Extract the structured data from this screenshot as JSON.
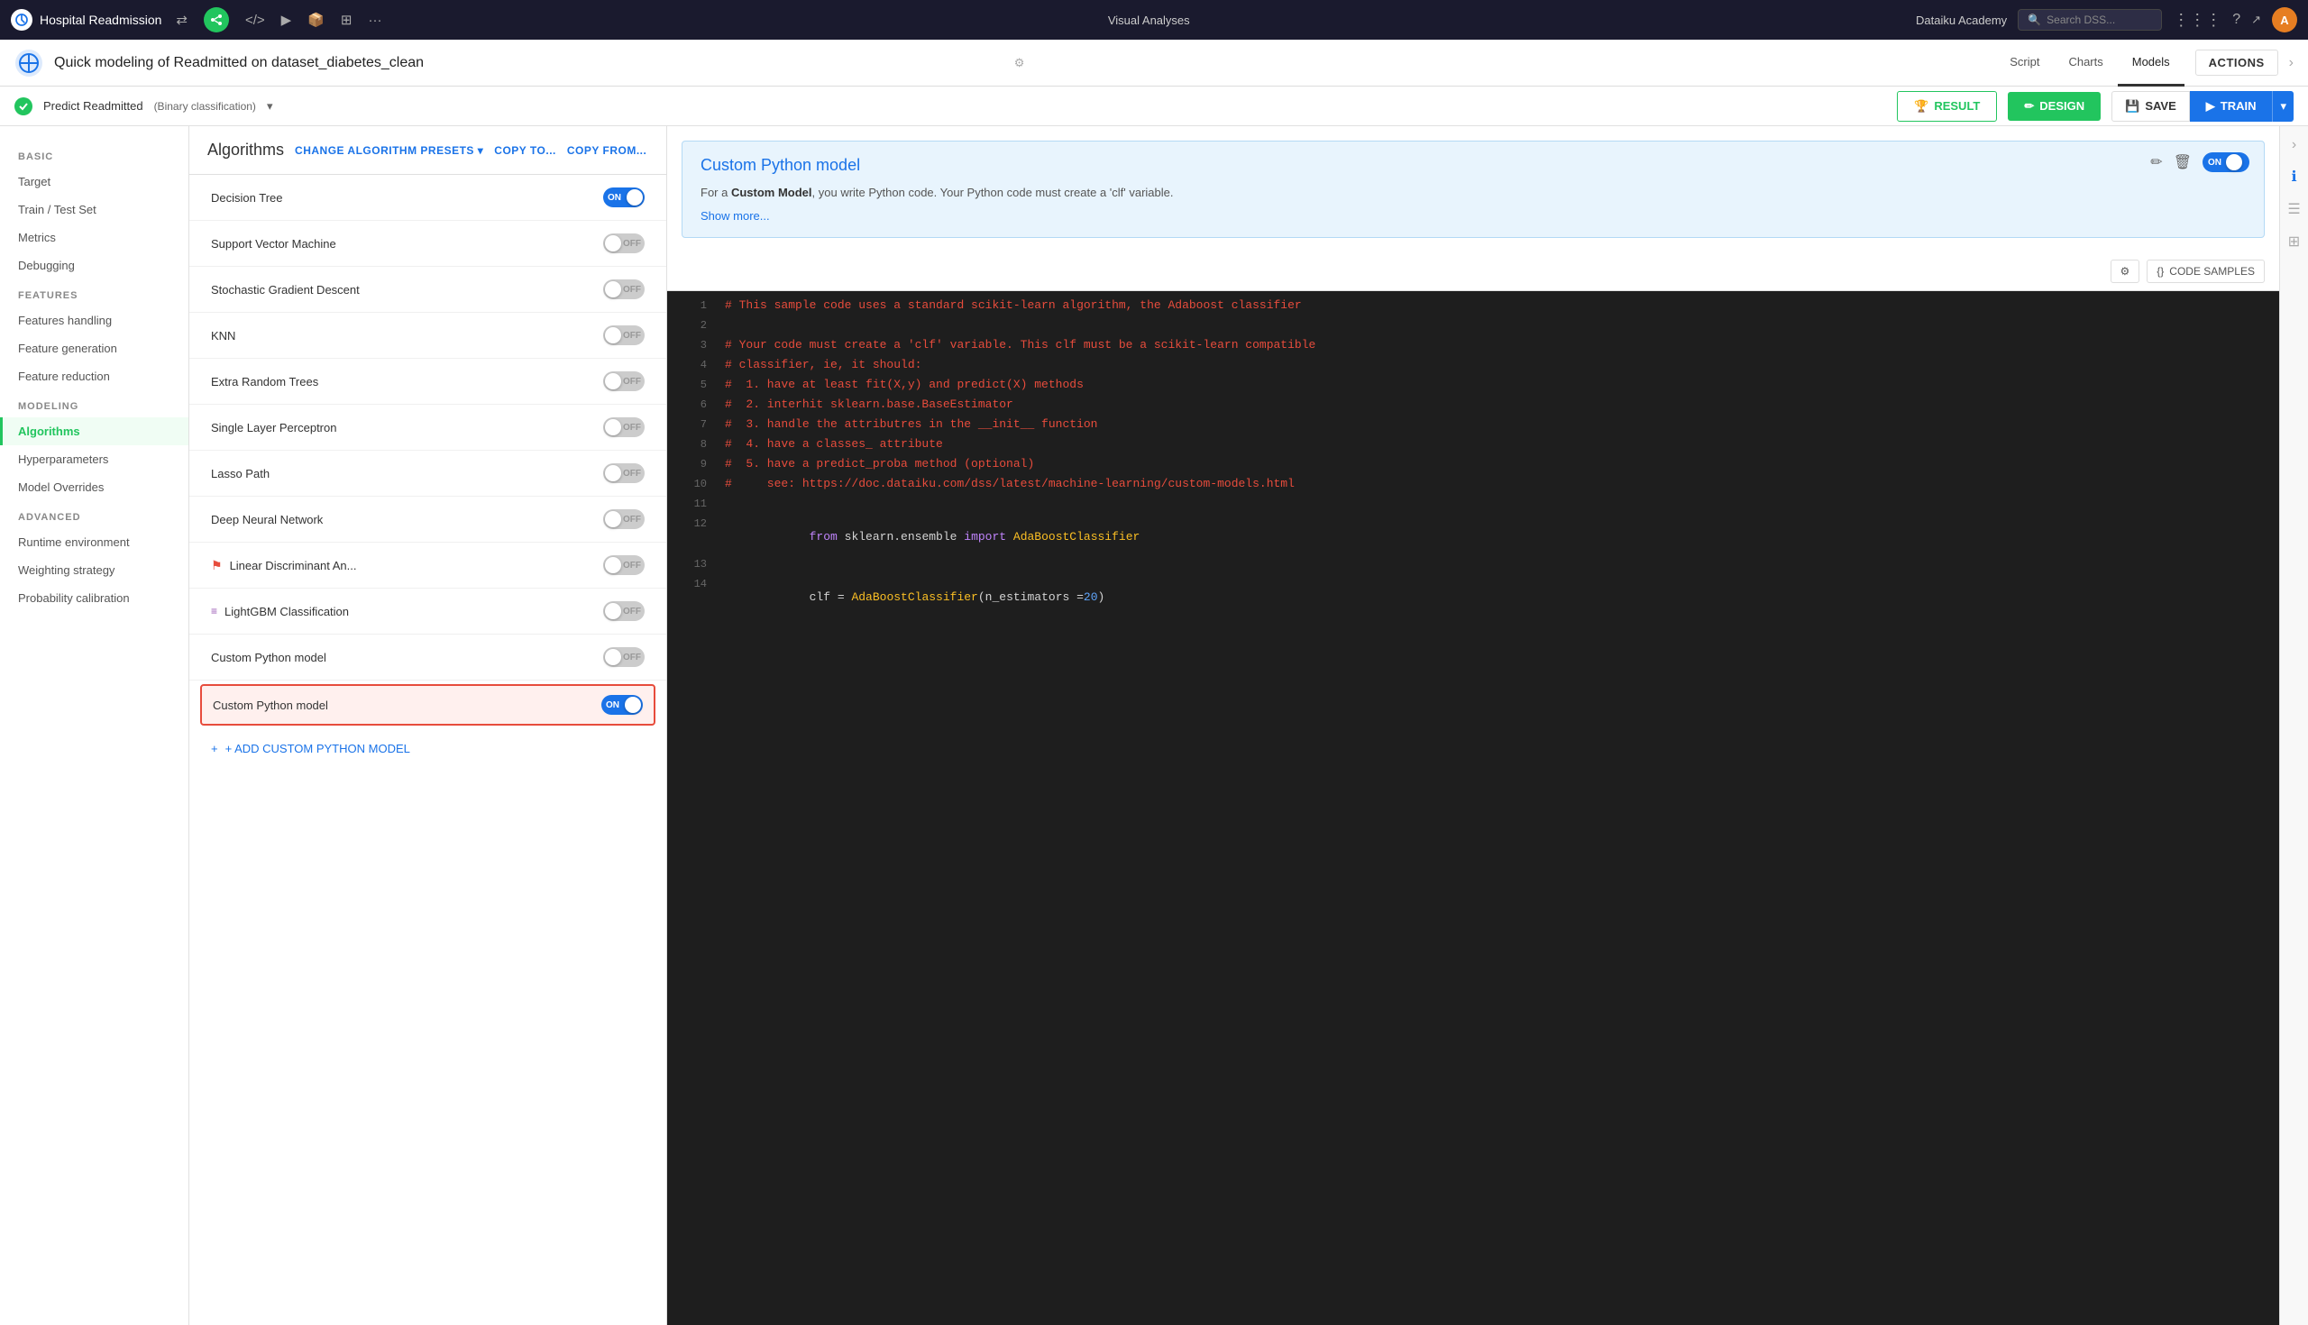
{
  "topbar": {
    "title": "Hospital Readmission",
    "center_label": "Visual Analyses",
    "academy_label": "Dataiku Academy",
    "search_placeholder": "Search DSS...",
    "user_initials": "A"
  },
  "secondbar": {
    "title": "Quick modeling of Readmitted on dataset_diabetes_clean",
    "tabs": [
      "Script",
      "Charts",
      "Models"
    ],
    "active_tab": "Models",
    "actions_btn": "ACTIONS"
  },
  "thirdbar": {
    "predict_label": "Predict Readmitted",
    "predict_type": "(Binary classification)",
    "design_btn": "DESIGN",
    "result_btn": "RESULT",
    "save_btn": "SAVE",
    "train_btn": "TRAIN"
  },
  "sidebar": {
    "sections": [
      {
        "label": "BASIC",
        "items": [
          "Target",
          "Train / Test Set",
          "Metrics",
          "Debugging"
        ]
      },
      {
        "label": "FEATURES",
        "items": [
          "Features handling",
          "Feature generation",
          "Feature reduction"
        ]
      },
      {
        "label": "MODELING",
        "items": [
          "Algorithms",
          "Hyperparameters",
          "Model Overrides"
        ]
      },
      {
        "label": "ADVANCED",
        "items": [
          "Runtime environment",
          "Weighting strategy",
          "Probability calibration"
        ]
      }
    ],
    "active_item": "Algorithms"
  },
  "algorithms": {
    "title": "Algorithms",
    "preset_btn": "CHANGE ALGORITHM PRESETS",
    "copy_to_btn": "COPY TO...",
    "copy_from_btn": "COPY FROM...",
    "items": [
      {
        "name": "Decision Tree",
        "state": "on",
        "icon": null
      },
      {
        "name": "Support Vector Machine",
        "state": "off",
        "icon": null
      },
      {
        "name": "Stochastic Gradient Descent",
        "state": "off",
        "icon": null
      },
      {
        "name": "KNN",
        "state": "off",
        "icon": null
      },
      {
        "name": "Extra Random Trees",
        "state": "off",
        "icon": null
      },
      {
        "name": "Single Layer Perceptron",
        "state": "off",
        "icon": null
      },
      {
        "name": "Lasso Path",
        "state": "off",
        "icon": null
      },
      {
        "name": "Deep Neural Network",
        "state": "off",
        "icon": null
      },
      {
        "name": "Linear Discriminant An...",
        "state": "off",
        "icon": "plugin"
      },
      {
        "name": "LightGBM Classification",
        "state": "off",
        "icon": "plugin2"
      },
      {
        "name": "Custom Python model",
        "state": "off",
        "icon": null
      },
      {
        "name": "Custom Python model",
        "state": "on",
        "highlighted": true,
        "icon": null
      }
    ],
    "add_btn": "+ ADD CUSTOM PYTHON MODEL"
  },
  "model_card": {
    "title": "Custom Python model",
    "description_prefix": "For a ",
    "description_bold": "Custom Model",
    "description_suffix": ", you write Python code. Your Python code must create a 'clf' variable.",
    "show_more": "Show more...",
    "toggle_state": "ON"
  },
  "code_editor": {
    "settings_icon": "⚙",
    "samples_btn": "CODE SAMPLES",
    "lines": [
      {
        "num": 1,
        "tokens": [
          {
            "type": "comment",
            "text": "# This sample code uses a standard scikit-learn algorithm, the Adaboost classifier"
          }
        ]
      },
      {
        "num": 2,
        "tokens": []
      },
      {
        "num": 3,
        "tokens": [
          {
            "type": "comment",
            "text": "# Your code must create a 'clf' variable. This clf must be a scikit-learn compatible"
          }
        ]
      },
      {
        "num": 4,
        "tokens": [
          {
            "type": "comment",
            "text": "# classifier, ie, it should:"
          }
        ]
      },
      {
        "num": 5,
        "tokens": [
          {
            "type": "comment",
            "text": "#  1. have at least fit(X,y) and predict(X) methods"
          }
        ]
      },
      {
        "num": 6,
        "tokens": [
          {
            "type": "comment",
            "text": "#  2. interhit sklearn.base.BaseEstimator"
          }
        ]
      },
      {
        "num": 7,
        "tokens": [
          {
            "type": "comment",
            "text": "#  3. handle the attributres in the __init__ function"
          }
        ]
      },
      {
        "num": 8,
        "tokens": [
          {
            "type": "comment",
            "text": "#  4. have a classes_ attribute"
          }
        ]
      },
      {
        "num": 9,
        "tokens": [
          {
            "type": "comment",
            "text": "#  5. have a predict_proba method (optional)"
          }
        ]
      },
      {
        "num": 10,
        "tokens": [
          {
            "type": "comment",
            "text": "#     see: https://doc.dataiku.com/dss/latest/machine-learning/custom-models.html"
          }
        ]
      },
      {
        "num": 11,
        "tokens": []
      },
      {
        "num": 12,
        "tokens": [
          {
            "type": "keyword",
            "text": "from"
          },
          {
            "type": "normal",
            "text": " sklearn.ensemble "
          },
          {
            "type": "keyword",
            "text": "import"
          },
          {
            "type": "class",
            "text": " AdaBoostClassifier"
          }
        ]
      },
      {
        "num": 13,
        "tokens": []
      },
      {
        "num": 14,
        "tokens": [
          {
            "type": "normal",
            "text": "clf = "
          },
          {
            "type": "func",
            "text": "AdaBoostClassifier"
          },
          {
            "type": "normal",
            "text": "(n_estimators ="
          },
          {
            "type": "number",
            "text": "20"
          },
          {
            "type": "normal",
            "text": ")"
          }
        ]
      }
    ]
  }
}
